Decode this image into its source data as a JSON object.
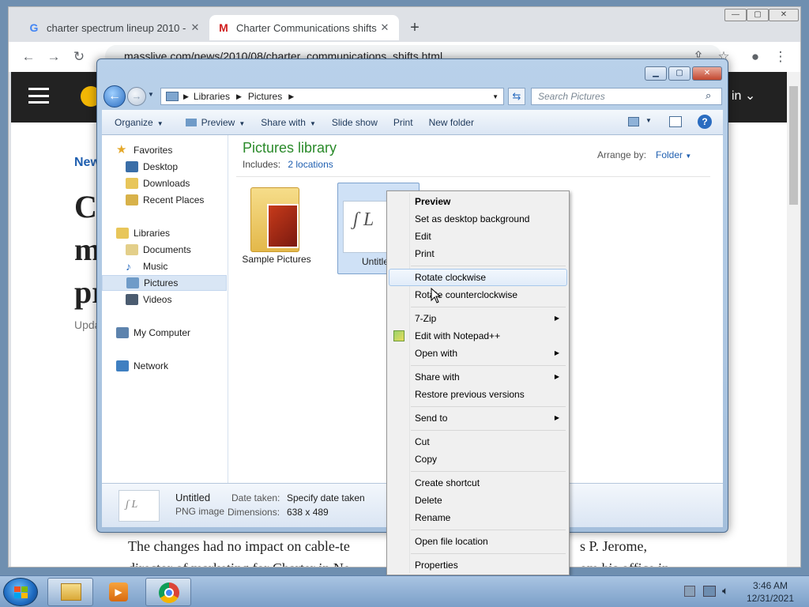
{
  "browser": {
    "tabs": [
      {
        "title": "charter spectrum lineup 2010 - G",
        "favicon": "google-icon"
      },
      {
        "title": "Charter Communications shifts T",
        "favicon": "masslive-icon"
      }
    ],
    "new_tab": "+",
    "url": "masslive.com/news/2010/08/charter_communications_shifts.html",
    "page": {
      "nav_left": "New",
      "headline_fragments": [
        "Cl",
        "m",
        "pr"
      ],
      "updated_fragment": "Upda",
      "signin_fragment": "in",
      "body_line1": "The changes had no impact on cable-te",
      "body_line1_end": "s P. Jerome,",
      "body_line2": "director of marketing for Charter in Ne",
      "body_line2_end": "om his office in"
    }
  },
  "explorer": {
    "breadcrumb": [
      "Libraries",
      "Pictures"
    ],
    "search_placeholder": "Search Pictures",
    "commands": [
      "Organize",
      "Preview",
      "Share with",
      "Slide show",
      "Print",
      "New folder"
    ],
    "nav": {
      "favorites_header": "Favorites",
      "favorites": [
        "Desktop",
        "Downloads",
        "Recent Places"
      ],
      "libraries_header": "Libraries",
      "libraries": [
        "Documents",
        "Music",
        "Pictures",
        "Videos"
      ],
      "computer": "My Computer",
      "network": "Network",
      "selected": "Pictures"
    },
    "library_title": "Pictures library",
    "includes_label": "Includes:",
    "includes_link": "2 locations",
    "arrange_label": "Arrange by:",
    "arrange_value": "Folder",
    "items": [
      {
        "name": "Sample Pictures",
        "type": "folder"
      },
      {
        "name": "Untitled",
        "type": "image",
        "selected": true
      }
    ],
    "details": {
      "name": "Untitled",
      "type": "PNG image",
      "date_label": "Date taken:",
      "date_value": "Specify date taken",
      "dims_label": "Dimensions:",
      "dims_value": "638 x 489"
    }
  },
  "context_menu": {
    "items": [
      {
        "label": "Preview",
        "bold": true
      },
      {
        "label": "Set as desktop background"
      },
      {
        "label": "Edit"
      },
      {
        "label": "Print"
      },
      {
        "label": "Rotate clockwise",
        "highlighted": true
      },
      {
        "label": "Rotate counterclockwise"
      },
      {
        "label": "7-Zip",
        "submenu": true
      },
      {
        "label": "Edit with Notepad++"
      },
      {
        "label": "Open with",
        "submenu": true
      },
      {
        "label": "Share with",
        "submenu": true
      },
      {
        "label": "Restore previous versions"
      },
      {
        "label": "Send to",
        "submenu": true
      },
      {
        "label": "Cut"
      },
      {
        "label": "Copy"
      },
      {
        "label": "Create shortcut"
      },
      {
        "label": "Delete"
      },
      {
        "label": "Rename"
      },
      {
        "label": "Open file location"
      },
      {
        "label": "Properties"
      }
    ]
  },
  "taskbar": {
    "time": "3:46 AM",
    "date": "12/31/2021"
  },
  "colors": {
    "library_title": "#2a8a2a",
    "link": "#1f5fb0",
    "taskbar": "#7b9fc8",
    "menu_highlight": "#e1ecf9"
  }
}
